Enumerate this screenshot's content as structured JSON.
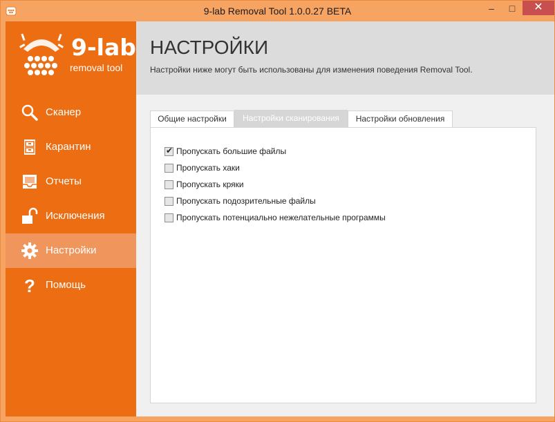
{
  "window": {
    "title": "9-lab Removal Tool 1.0.0.27 BETA",
    "minimize_icon": "minimize-icon",
    "maximize_icon": "maximize-icon",
    "close_icon": "close-icon",
    "minimize_glyph": "–",
    "maximize_glyph": "□",
    "close_glyph": "✕"
  },
  "logo": {
    "name": "9-lab",
    "sub": "removal tool"
  },
  "sidebar": {
    "items": [
      {
        "label": "Сканер",
        "icon": "search-icon"
      },
      {
        "label": "Карантин",
        "icon": "cabinet-icon"
      },
      {
        "label": "Отчеты",
        "icon": "report-icon"
      },
      {
        "label": "Исключения",
        "icon": "unlock-icon"
      },
      {
        "label": "Настройки",
        "icon": "gear-icon",
        "active": true
      },
      {
        "label": "Помощь",
        "icon": "help-icon"
      }
    ]
  },
  "header": {
    "title": "НАСТРОЙКИ",
    "subtitle": "Настройки ниже могут быть использованы для изменения поведения Removal Tool."
  },
  "tabs": [
    {
      "label": "Общие настройки"
    },
    {
      "label": "Настройки сканирования",
      "active": true
    },
    {
      "label": "Настройки обновления"
    }
  ],
  "options": [
    {
      "label": "Пропускать большие файлы",
      "checked": true
    },
    {
      "label": "Пропускать хаки",
      "checked": false
    },
    {
      "label": "Пропускать кряки",
      "checked": false
    },
    {
      "label": "Пропускать подозрительные файлы",
      "checked": false
    },
    {
      "label": "Пропускать потенциально нежелательные программы",
      "checked": false
    }
  ],
  "colors": {
    "accent": "#ed6d13",
    "active_nav": "#f0955c",
    "frame": "#f7a362",
    "close": "#c74f4f"
  }
}
